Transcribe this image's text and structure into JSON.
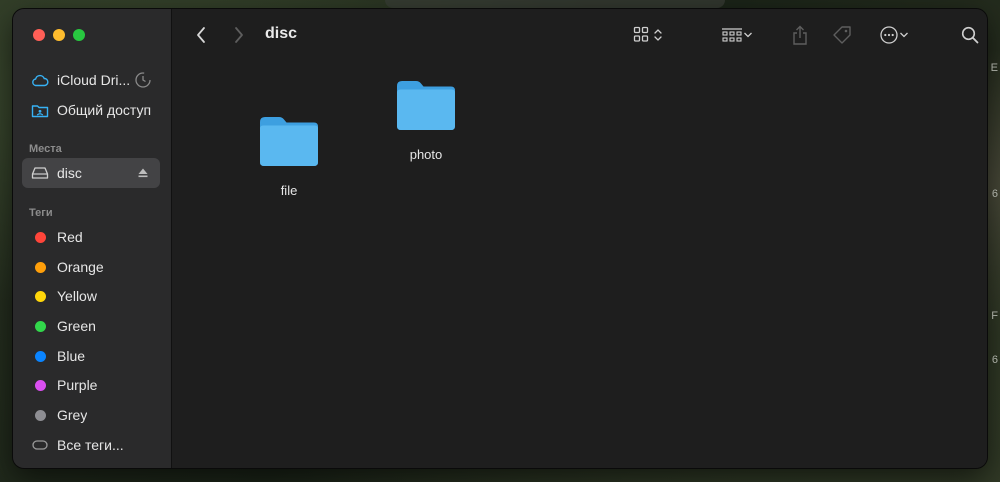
{
  "window": {
    "title": "disc"
  },
  "sidebar": {
    "favorites": [
      {
        "label": "iCloud Dri...",
        "icon": "icloud-icon"
      },
      {
        "label": "Общий доступ",
        "icon": "shared-folder-icon"
      }
    ],
    "places_header": "Места",
    "places": [
      {
        "label": "disc",
        "icon": "drive-icon",
        "selected": true
      }
    ],
    "tags_header": "Теги",
    "tags": [
      {
        "label": "Red",
        "color": "#ff453a"
      },
      {
        "label": "Orange",
        "color": "#ff9f0a"
      },
      {
        "label": "Yellow",
        "color": "#ffd60a"
      },
      {
        "label": "Green",
        "color": "#32d74b"
      },
      {
        "label": "Blue",
        "color": "#0a84ff"
      },
      {
        "label": "Purple",
        "color": "#da4ff0"
      },
      {
        "label": "Grey",
        "color": "#8e8e93"
      }
    ],
    "all_tags": "Все теги..."
  },
  "toolbar": {
    "icons": [
      "back-icon",
      "forward-icon",
      "icon-view-icon",
      "group-icon",
      "share-icon",
      "tag-icon",
      "more-actions-icon",
      "search-icon"
    ]
  },
  "files": [
    {
      "name": "file",
      "type": "folder"
    },
    {
      "name": "photo",
      "type": "folder"
    }
  ],
  "colors": {
    "accent": "#37b2f5",
    "folder": "#5ab8f0"
  }
}
